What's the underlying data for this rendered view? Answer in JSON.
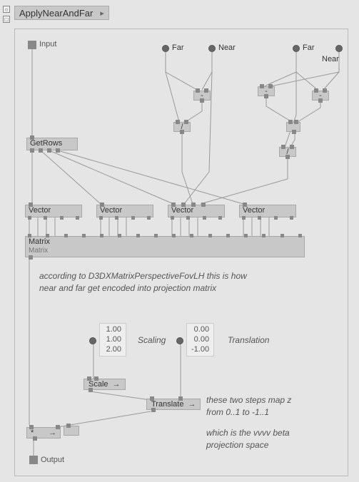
{
  "title": "ApplyNearAndFar",
  "io": {
    "input": "Input",
    "output": "Output"
  },
  "top": {
    "far1": "Far",
    "near1": "Near",
    "far2": "Far",
    "near2": "Near"
  },
  "smallops": {
    "sub1": "-",
    "sub2": "-",
    "sub3": "-",
    "div1": "/",
    "div2": "/",
    "mul": "*"
  },
  "nodes": {
    "getrows": "GetRows",
    "vec1": "Vector",
    "vec2": "Vector",
    "vec3": "Vector",
    "vec4": "Vector",
    "matrix": "Matrix",
    "matrix_sub": "Matrix",
    "scale": "Scale",
    "translate": "Translate"
  },
  "comments": {
    "c1a": "according to D3DXMatrixPerspectiveFovLH this is how",
    "c1b": "near and far get encoded into projection matrix",
    "scaling_label": "Scaling",
    "translation_label": "Translation",
    "c2a": "these two steps map z",
    "c2b": "from 0..1 to -1..1",
    "c3a": "which is the vvvv beta",
    "c3b": "projection space"
  },
  "values": {
    "scaling": [
      "1.00",
      "1.00",
      "2.00"
    ],
    "translation": [
      "0.00",
      "0.00",
      "-1.00"
    ]
  }
}
